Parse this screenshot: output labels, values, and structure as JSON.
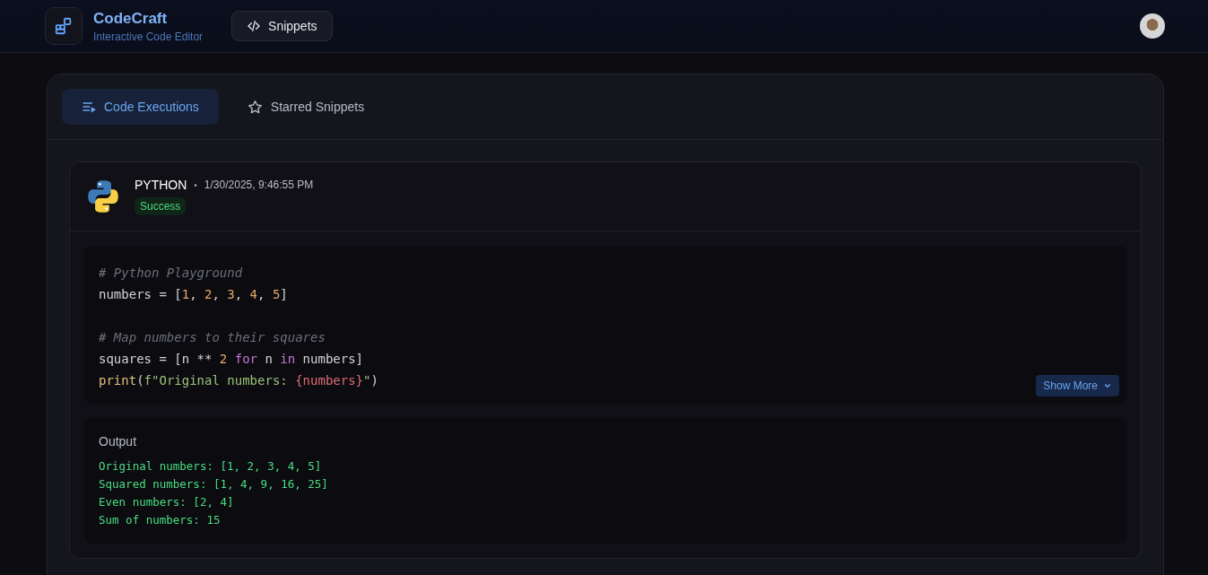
{
  "header": {
    "app_name": "CodeCraft",
    "tagline": "Interactive Code Editor",
    "nav_button": "Snippets"
  },
  "tabs": [
    {
      "label": "Code Executions",
      "kind": "executions",
      "selected": true
    },
    {
      "label": "Starred Snippets",
      "kind": "starred",
      "selected": false
    }
  ],
  "execution": {
    "language": "PYTHON",
    "separator": "•",
    "timestamp": "1/30/2025, 9:46:55 PM",
    "status": "Success",
    "code_lines": [
      {
        "kind": "code",
        "tokens": [
          {
            "text": "# Python Playground",
            "kind": "comment"
          }
        ]
      },
      {
        "kind": "code",
        "tokens": [
          {
            "text": "numbers = [",
            "kind": "plain"
          },
          {
            "text": "1",
            "kind": "number"
          },
          {
            "text": ", ",
            "kind": "plain"
          },
          {
            "text": "2",
            "kind": "number"
          },
          {
            "text": ", ",
            "kind": "plain"
          },
          {
            "text": "3",
            "kind": "number"
          },
          {
            "text": ", ",
            "kind": "plain"
          },
          {
            "text": "4",
            "kind": "number"
          },
          {
            "text": ", ",
            "kind": "plain"
          },
          {
            "text": "5",
            "kind": "number"
          },
          {
            "text": "]",
            "kind": "plain"
          }
        ]
      },
      {
        "kind": "blank"
      },
      {
        "kind": "code",
        "tokens": [
          {
            "text": "# Map numbers to their squares",
            "kind": "comment"
          }
        ]
      },
      {
        "kind": "code",
        "tokens": [
          {
            "text": "squares = [n ** ",
            "kind": "plain"
          },
          {
            "text": "2",
            "kind": "number"
          },
          {
            "text": " for",
            "kind": "keyword"
          },
          {
            "text": " n ",
            "kind": "plain"
          },
          {
            "text": "in",
            "kind": "keyword"
          },
          {
            "text": " numbers]",
            "kind": "plain"
          }
        ]
      },
      {
        "kind": "code",
        "tokens": [
          {
            "text": "print",
            "kind": "func"
          },
          {
            "text": "(",
            "kind": "plain"
          },
          {
            "text": "f\"Original numbers: ",
            "kind": "string"
          },
          {
            "text": "{numbers}",
            "kind": "interp"
          },
          {
            "text": "\"",
            "kind": "string"
          },
          {
            "text": ")",
            "kind": "plain"
          }
        ]
      }
    ],
    "show_more": "Show More",
    "output_title": "Output",
    "output_lines": [
      "Original numbers: [1, 2, 3, 4, 5]",
      "Squared numbers: [1, 4, 9, 16, 25]",
      "Even numbers: [2, 4]",
      "Sum of numbers: 15"
    ]
  }
}
